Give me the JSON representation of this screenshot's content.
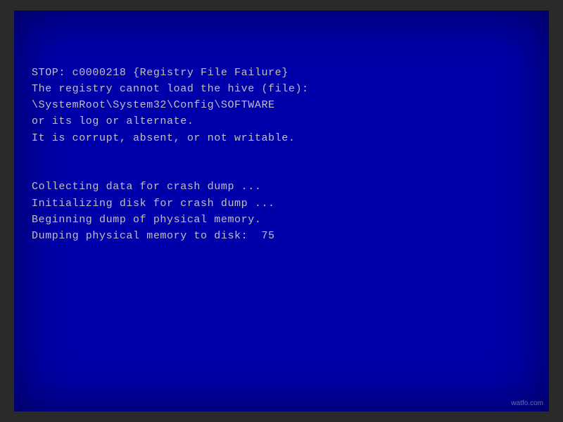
{
  "screen": {
    "background_color": "#0000aa",
    "text_color": "#c0c0c0"
  },
  "bsod": {
    "lines": [
      "STOP: c0000218 {Registry File Failure}",
      "The registry cannot load the hive (file):",
      "\\SystemRoot\\System32\\Config\\SOFTWARE",
      "or its log or alternate.",
      "It is corrupt, absent, or not writable.",
      "",
      "",
      "Collecting data for crash dump ...",
      "Initializing disk for crash dump ...",
      "Beginning dump of physical memory.",
      "Dumping physical memory to disk:  75"
    ]
  },
  "watermark": {
    "text": "watfo.com"
  }
}
